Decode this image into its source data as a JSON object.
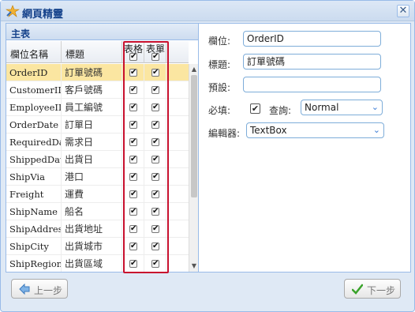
{
  "window": {
    "title": "網頁精靈"
  },
  "grid": {
    "panel_title": "主表",
    "columns": {
      "name": "欄位名稱",
      "title": "標題",
      "grid": "表格",
      "form": "表單"
    },
    "rows": [
      {
        "name": "OrderID",
        "title": "訂單號碼",
        "grid": true,
        "form": true,
        "selected": true
      },
      {
        "name": "CustomerID",
        "title": "客戶號碼",
        "grid": true,
        "form": true
      },
      {
        "name": "EmployeeID",
        "title": "員工編號",
        "grid": true,
        "form": true
      },
      {
        "name": "OrderDate",
        "title": "訂單日",
        "grid": true,
        "form": true
      },
      {
        "name": "RequiredDate",
        "title": "需求日",
        "grid": true,
        "form": true
      },
      {
        "name": "ShippedDate",
        "title": "出貨日",
        "grid": true,
        "form": true
      },
      {
        "name": "ShipVia",
        "title": "港口",
        "grid": true,
        "form": true
      },
      {
        "name": "Freight",
        "title": "運費",
        "grid": true,
        "form": true
      },
      {
        "name": "ShipName",
        "title": "船名",
        "grid": true,
        "form": true
      },
      {
        "name": "ShipAddress",
        "title": "出貨地址",
        "grid": true,
        "form": true
      },
      {
        "name": "ShipCity",
        "title": "出貨城市",
        "grid": true,
        "form": true
      },
      {
        "name": "ShipRegion",
        "title": "出貨區域",
        "grid": true,
        "form": true
      }
    ]
  },
  "form": {
    "field_label": "欄位:",
    "field_value": "OrderID",
    "title_label": "標題:",
    "title_value": "訂單號碼",
    "default_label": "預設:",
    "default_value": "",
    "required_label": "必填:",
    "required_checked": true,
    "query_label": "查詢:",
    "query_value": "Normal",
    "editor_label": "編輯器:",
    "editor_value": "TextBox"
  },
  "buttons": {
    "prev": "上一步",
    "next": "下一步"
  },
  "colors": {
    "highlight_border": "#c8102e",
    "selected_row": "#fbe6a1",
    "input_border": "#7eadd9"
  }
}
